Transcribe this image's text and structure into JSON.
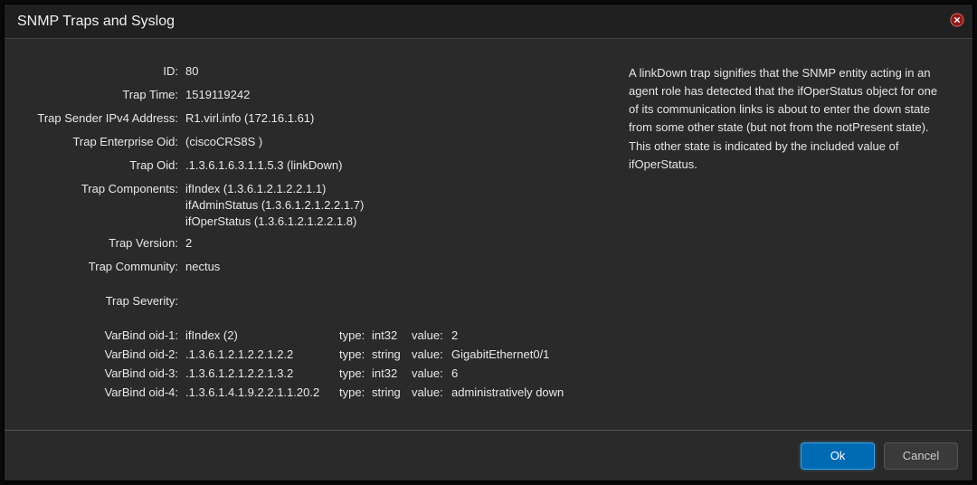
{
  "dialog": {
    "title": "SNMP Traps and Syslog"
  },
  "fields": {
    "id_label": "ID:",
    "id_value": "80",
    "trap_time_label": "Trap Time:",
    "trap_time_value": "1519119242",
    "sender_label": "Trap Sender IPv4 Address:",
    "sender_value": "R1.virl.info (172.16.1.61)",
    "enterprise_label": "Trap Enterprise Oid:",
    "enterprise_value": "(ciscoCRS8S )",
    "trap_oid_label": "Trap Oid:",
    "trap_oid_value": ".1.3.6.1.6.3.1.1.5.3 (linkDown)",
    "components_label": "Trap Components:",
    "components_1": "ifIndex (1.3.6.1.2.1.2.2.1.1)",
    "components_2": "ifAdminStatus (1.3.6.1.2.1.2.2.1.7)",
    "components_3": "ifOperStatus (1.3.6.1.2.1.2.2.1.8)",
    "version_label": "Trap Version:",
    "version_value": "2",
    "community_label": "Trap Community:",
    "community_value": "nectus",
    "severity_label": "Trap Severity:",
    "severity_value": ""
  },
  "varbinds": {
    "type_label": "type:",
    "value_label": "value:",
    "rows": [
      {
        "label": "VarBind oid-1:",
        "oid": "ifIndex (2)",
        "type": "int32",
        "value": "2"
      },
      {
        "label": "VarBind oid-2:",
        "oid": ".1.3.6.1.2.1.2.2.1.2.2",
        "type": "string",
        "value": "GigabitEthernet0/1"
      },
      {
        "label": "VarBind oid-3:",
        "oid": ".1.3.6.1.2.1.2.2.1.3.2",
        "type": "int32",
        "value": "6"
      },
      {
        "label": "VarBind oid-4:",
        "oid": ".1.3.6.1.4.1.9.2.2.1.1.20.2",
        "type": "string",
        "value": "administratively down"
      }
    ]
  },
  "description": "A linkDown trap signifies that the SNMP entity acting in an agent role has detected that the ifOperStatus object for one of its communication links is about to enter the down state from some other state (but not from the notPresent state). This other state is indicated by the included value of ifOperStatus.",
  "buttons": {
    "ok": "Ok",
    "cancel": "Cancel"
  }
}
